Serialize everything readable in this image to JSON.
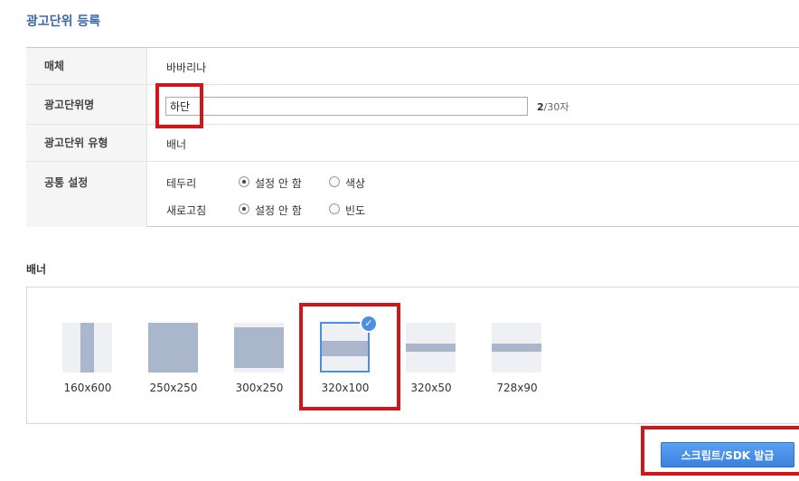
{
  "page": {
    "title": "광고단위 등록"
  },
  "form": {
    "media": {
      "label": "매체",
      "value": "바바리나"
    },
    "unit_name": {
      "label": "광고단위명",
      "value": "하단",
      "count": "2",
      "max_text": "/30자"
    },
    "unit_type": {
      "label": "광고단위 유형",
      "value": "배너"
    },
    "common": {
      "label": "공통 설정",
      "border": {
        "label": "테두리",
        "options": [
          "설정 안 함",
          "색상"
        ],
        "selected": 0
      },
      "refresh": {
        "label": "새로고침",
        "options": [
          "설정 안 함",
          "빈도"
        ],
        "selected": 0
      }
    }
  },
  "banner": {
    "section_title": "배너",
    "sizes": [
      "160x600",
      "250x250",
      "300x250",
      "320x100",
      "320x50",
      "728x90"
    ],
    "selected": "320x100"
  },
  "actions": {
    "issue_label": "스크립트/SDK 발급"
  },
  "colors": {
    "accent": "#4a90e2",
    "highlight": "#d0161b",
    "title": "#3d68a8",
    "thumb_fill": "#a9b6cc"
  }
}
